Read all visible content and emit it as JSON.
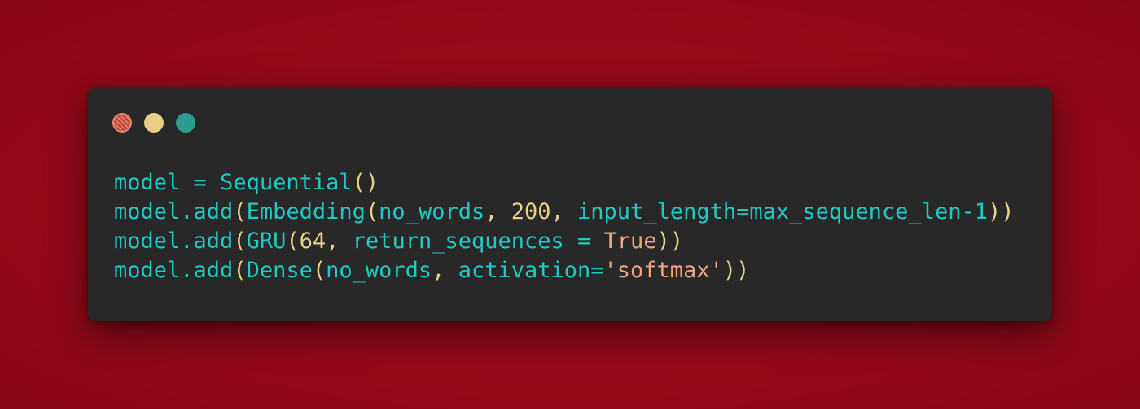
{
  "colors": {
    "background": "#960a1a",
    "window_bg": "#282828",
    "identifier": "#20c9c4",
    "punctuation": "#e7d184",
    "number": "#e7d184",
    "literal": "#f4a37f"
  },
  "window_controls": {
    "close_icon": "close-dot-icon",
    "minimize_icon": "minimize-dot-icon",
    "maximize_icon": "maximize-dot-icon"
  },
  "code_lines": [
    {
      "tokens": [
        {
          "t": "model",
          "c": "var"
        },
        {
          "t": " = ",
          "c": "op"
        },
        {
          "t": "Sequential",
          "c": "var"
        },
        {
          "t": "()",
          "c": "punc"
        }
      ]
    },
    {
      "tokens": [
        {
          "t": "model",
          "c": "var"
        },
        {
          "t": ".",
          "c": "op"
        },
        {
          "t": "add",
          "c": "var"
        },
        {
          "t": "(",
          "c": "punc"
        },
        {
          "t": "Embedding",
          "c": "var"
        },
        {
          "t": "(",
          "c": "punc"
        },
        {
          "t": "no_words",
          "c": "var"
        },
        {
          "t": ", ",
          "c": "punc"
        },
        {
          "t": "200",
          "c": "num"
        },
        {
          "t": ", ",
          "c": "punc"
        },
        {
          "t": "input_length",
          "c": "var"
        },
        {
          "t": "=",
          "c": "op"
        },
        {
          "t": "max_sequence_len",
          "c": "var"
        },
        {
          "t": "-",
          "c": "op"
        },
        {
          "t": "1",
          "c": "var"
        },
        {
          "t": "))",
          "c": "punc"
        }
      ]
    },
    {
      "tokens": [
        {
          "t": "model",
          "c": "var"
        },
        {
          "t": ".",
          "c": "op"
        },
        {
          "t": "add",
          "c": "var"
        },
        {
          "t": "(",
          "c": "punc"
        },
        {
          "t": "GRU",
          "c": "var"
        },
        {
          "t": "(",
          "c": "punc"
        },
        {
          "t": "64",
          "c": "num"
        },
        {
          "t": ", ",
          "c": "punc"
        },
        {
          "t": "return_sequences",
          "c": "var"
        },
        {
          "t": " = ",
          "c": "op"
        },
        {
          "t": "True",
          "c": "bool"
        },
        {
          "t": "))",
          "c": "punc"
        }
      ]
    },
    {
      "tokens": [
        {
          "t": "model",
          "c": "var"
        },
        {
          "t": ".",
          "c": "op"
        },
        {
          "t": "add",
          "c": "var"
        },
        {
          "t": "(",
          "c": "punc"
        },
        {
          "t": "Dense",
          "c": "var"
        },
        {
          "t": "(",
          "c": "punc"
        },
        {
          "t": "no_words",
          "c": "var"
        },
        {
          "t": ", ",
          "c": "punc"
        },
        {
          "t": "activation",
          "c": "var"
        },
        {
          "t": "=",
          "c": "op"
        },
        {
          "t": "'softmax'",
          "c": "str"
        },
        {
          "t": "))",
          "c": "punc"
        }
      ]
    }
  ]
}
